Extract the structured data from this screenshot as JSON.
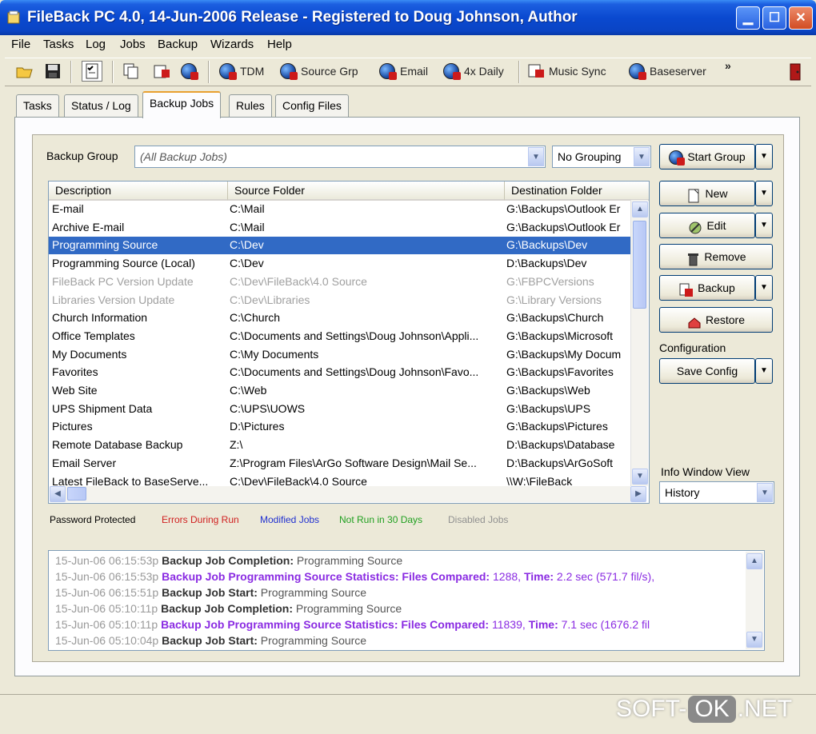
{
  "window": {
    "title": "FileBack PC 4.0, 14-Jun-2006 Release - Registered to Doug Johnson, Author"
  },
  "menu": [
    "File",
    "Tasks",
    "Log",
    "Jobs",
    "Backup",
    "Wizards",
    "Help"
  ],
  "toolbar": {
    "buttons": [
      {
        "label": "TDM"
      },
      {
        "label": "Source Grp"
      },
      {
        "label": "Email"
      },
      {
        "label": "4x Daily"
      },
      {
        "label": "Music Sync"
      },
      {
        "label": "Baseserver"
      }
    ],
    "overflow": "»"
  },
  "tabs": [
    "Tasks",
    "Status / Log",
    "Backup Jobs",
    "Rules",
    "Config Files"
  ],
  "backup_group": {
    "label": "Backup Group",
    "value": "(All Backup Jobs)",
    "grouping": "No Grouping",
    "start_label": "Start Group"
  },
  "table": {
    "columns": [
      "Description",
      "Source Folder",
      "Destination Folder"
    ],
    "rows": [
      {
        "desc": "E-mail",
        "src": "C:\\Mail",
        "dst": "G:\\Backups\\Outlook Er"
      },
      {
        "desc": "Archive E-mail",
        "src": "C:\\Mail",
        "dst": "G:\\Backups\\Outlook Er"
      },
      {
        "desc": "Programming Source",
        "src": "C:\\Dev",
        "dst": "G:\\Backups\\Dev"
      },
      {
        "desc": "Programming Source (Local)",
        "src": "C:\\Dev",
        "dst": "D:\\Backups\\Dev"
      },
      {
        "desc": "FileBack PC Version Update",
        "src": "C:\\Dev\\FileBack\\4.0 Source",
        "dst": "G:\\FBPCVersions"
      },
      {
        "desc": "Libraries Version Update",
        "src": "C:\\Dev\\Libraries",
        "dst": "G:\\Library Versions"
      },
      {
        "desc": "Church Information",
        "src": "C:\\Church",
        "dst": "G:\\Backups\\Church"
      },
      {
        "desc": "Office Templates",
        "src": "C:\\Documents and Settings\\Doug Johnson\\Appli...",
        "dst": "G:\\Backups\\Microsoft"
      },
      {
        "desc": "My Documents",
        "src": "C:\\My Documents",
        "dst": "G:\\Backups\\My Docum"
      },
      {
        "desc": "Favorites",
        "src": "C:\\Documents and Settings\\Doug Johnson\\Favo...",
        "dst": "G:\\Backups\\Favorites"
      },
      {
        "desc": "Web Site",
        "src": "C:\\Web",
        "dst": "G:\\Backups\\Web"
      },
      {
        "desc": "UPS Shipment Data",
        "src": "C:\\UPS\\UOWS",
        "dst": "G:\\Backups\\UPS"
      },
      {
        "desc": "Pictures",
        "src": "D:\\Pictures",
        "dst": "G:\\Backups\\Pictures"
      },
      {
        "desc": "Remote Database Backup",
        "src": "Z:\\",
        "dst": "D:\\Backups\\Database"
      },
      {
        "desc": "Email Server",
        "src": "Z:\\Program Files\\ArGo Software Design\\Mail Se...",
        "dst": "D:\\Backups\\ArGoSoft"
      },
      {
        "desc": "Latest FileBack to BaseServe...",
        "src": "C:\\Dev\\FileBack\\4.0 Source",
        "dst": "\\\\W:\\FileBack"
      }
    ]
  },
  "actions": {
    "new": "New",
    "edit": "Edit",
    "remove": "Remove",
    "backup": "Backup",
    "restore": "Restore",
    "configuration_label": "Configuration",
    "save_config": "Save Config",
    "info_window_label": "Info Window View",
    "info_window_value": "History"
  },
  "legend": {
    "password": "Password Protected",
    "errors": "Errors During Run",
    "modified": "Modified Jobs",
    "not_run": "Not Run in 30 Days",
    "disabled": "Disabled Jobs",
    "colors": {
      "password": "#000000",
      "errors": "#d02020",
      "modified": "#2030d0",
      "not_run": "#20a020",
      "disabled": "#909090"
    }
  },
  "log": [
    {
      "ts": "15-Jun-06 06:15:53p",
      "title": "Backup Job Completion:",
      "text": " Programming Source",
      "style": "normal"
    },
    {
      "ts": "15-Jun-06 06:15:53p",
      "title": "Backup Job Programming Source Statistics: Files Compared:",
      "text": " 1288, ",
      "title2": "Time:",
      "text2": " 2.2 sec (571.7 fil/s),",
      "style": "stats"
    },
    {
      "ts": "15-Jun-06 06:15:51p",
      "title": "Backup Job Start:",
      "text": " Programming Source",
      "style": "normal"
    },
    {
      "ts": "15-Jun-06 05:10:11p",
      "title": "Backup Job Completion:",
      "text": " Programming Source",
      "style": "normal"
    },
    {
      "ts": "15-Jun-06 05:10:11p",
      "title": "Backup Job Programming Source Statistics: Files Compared:",
      "text": " 11839, ",
      "title2": "Time:",
      "text2": " 7.1 sec (1676.2 fil",
      "style": "stats"
    },
    {
      "ts": "15-Jun-06 05:10:04p",
      "title": "Backup Job Start:",
      "text": " Programming Source",
      "style": "normal"
    }
  ],
  "watermark": {
    "left": "SOFT-",
    "mid": "OK",
    "right": ".NET"
  }
}
